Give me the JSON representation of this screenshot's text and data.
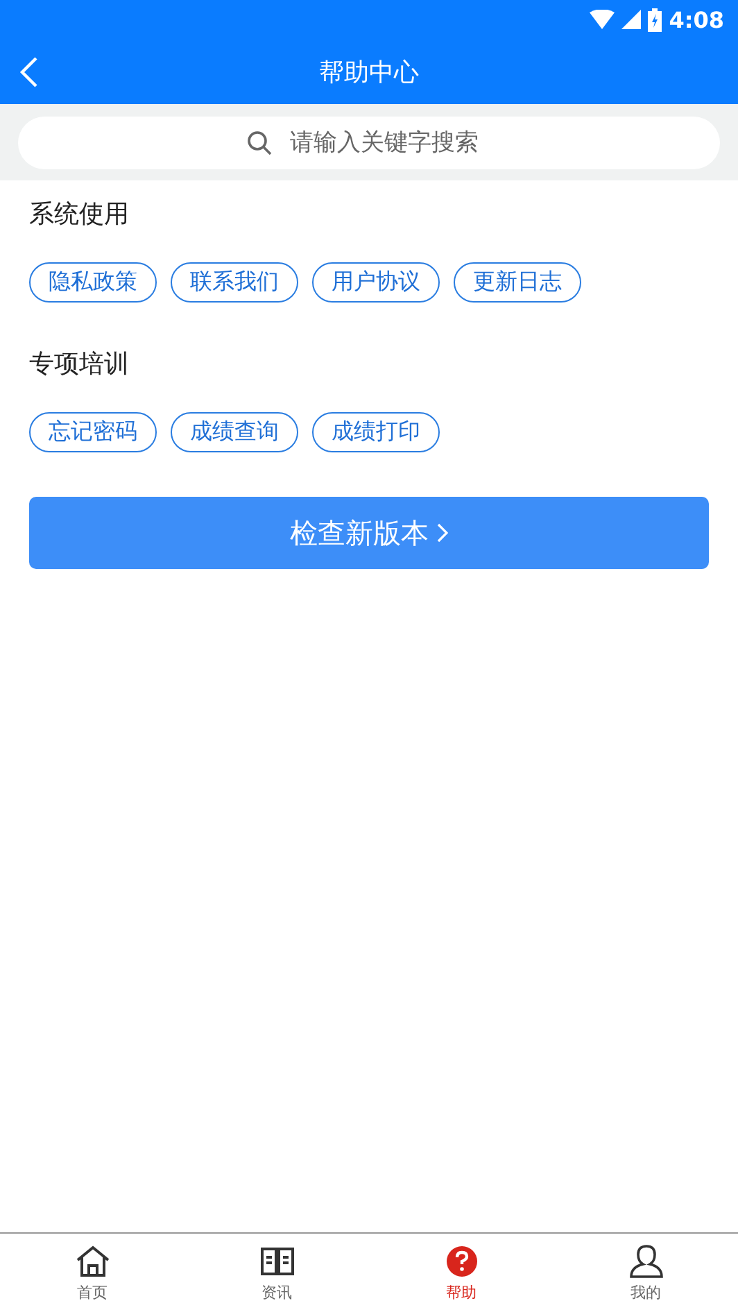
{
  "status_bar": {
    "time": "4:08"
  },
  "header": {
    "title": "帮助中心"
  },
  "search": {
    "placeholder": "请输入关键字搜索"
  },
  "sections": [
    {
      "title": "系统使用",
      "items": [
        "隐私政策",
        "联系我们",
        "用户协议",
        "更新日志"
      ]
    },
    {
      "title": "专项培训",
      "items": [
        "忘记密码",
        "成绩查询",
        "成绩打印"
      ]
    }
  ],
  "update_button": {
    "label": "检查新版本"
  },
  "tabs": [
    {
      "label": "首页",
      "selected": false
    },
    {
      "label": "资讯",
      "selected": false
    },
    {
      "label": "帮助",
      "selected": true
    },
    {
      "label": "我的",
      "selected": false
    }
  ]
}
